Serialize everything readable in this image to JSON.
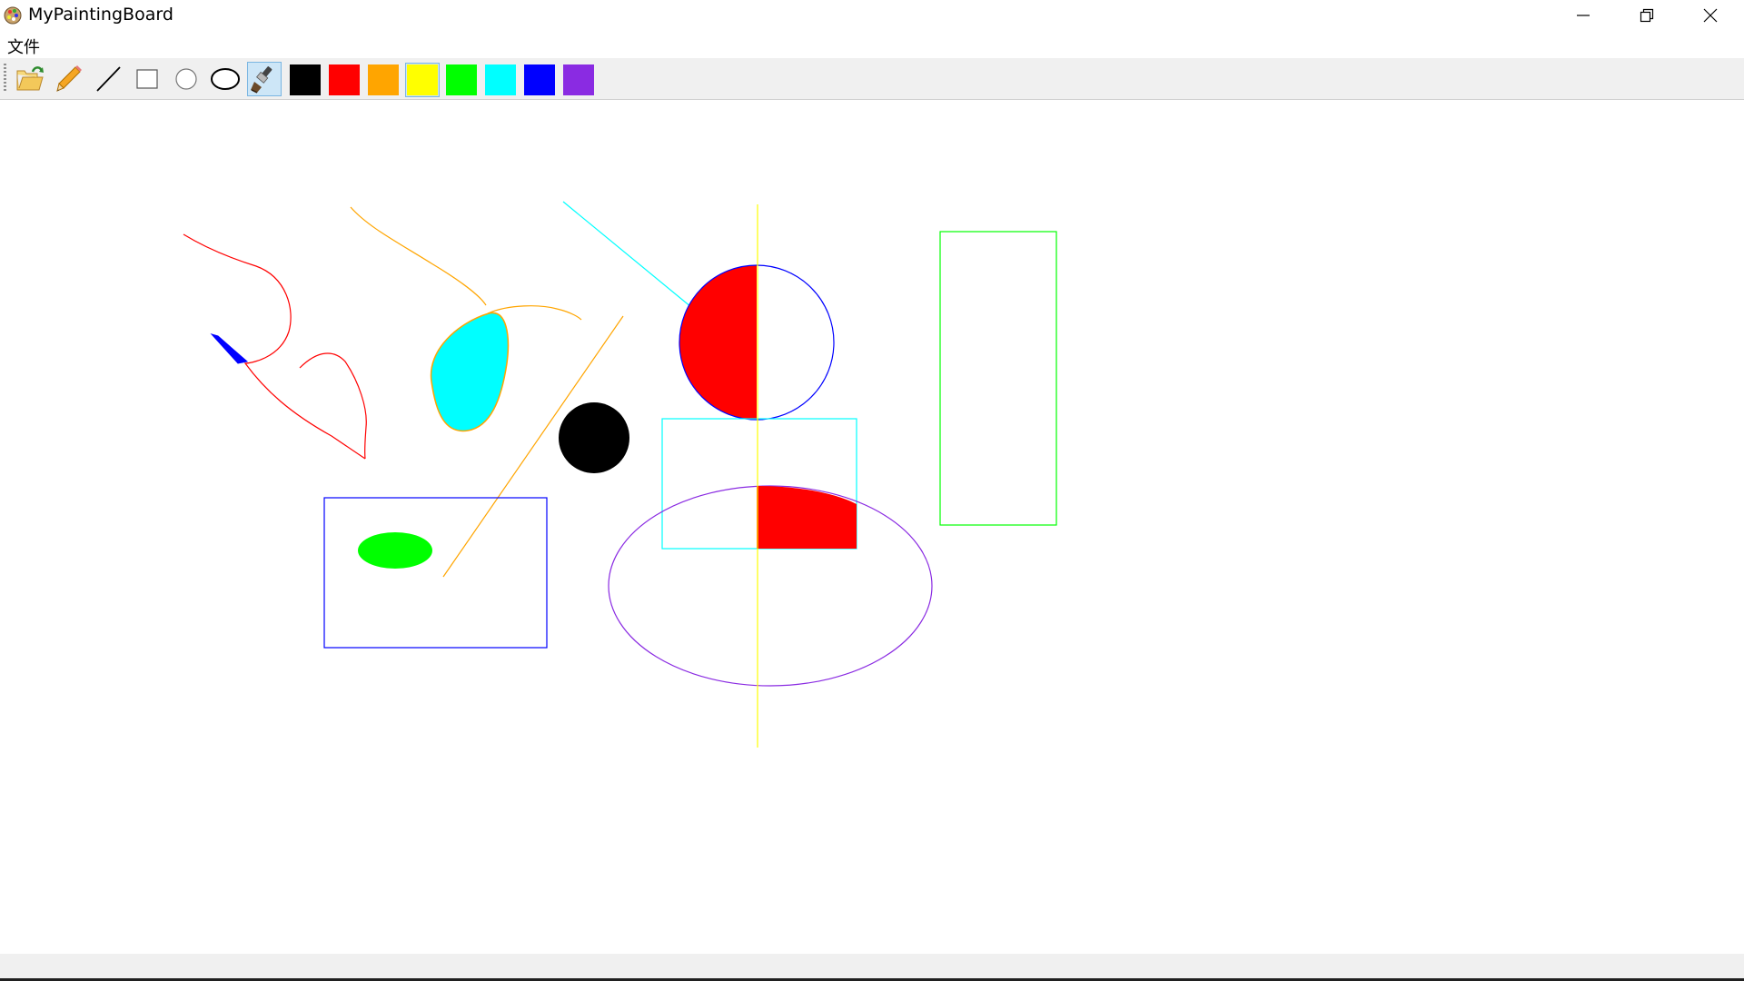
{
  "window": {
    "title": "MyPaintingBoard",
    "controls": [
      "minimize",
      "restore",
      "close"
    ]
  },
  "menu": {
    "items": [
      {
        "label": "文件"
      }
    ]
  },
  "toolbar": {
    "tools": [
      {
        "name": "open",
        "icon": "open-folder-icon"
      },
      {
        "name": "pencil",
        "icon": "pencil-icon"
      },
      {
        "name": "line",
        "icon": "line-icon"
      },
      {
        "name": "rectangle",
        "icon": "rectangle-icon"
      },
      {
        "name": "circle",
        "icon": "circle-icon"
      },
      {
        "name": "ellipse",
        "icon": "ellipse-icon"
      },
      {
        "name": "fill-brush",
        "icon": "paint-brush-icon",
        "selected": true
      }
    ],
    "colors": [
      {
        "name": "black",
        "hex": "#000000"
      },
      {
        "name": "red",
        "hex": "#ff0000"
      },
      {
        "name": "orange",
        "hex": "#ffa500"
      },
      {
        "name": "yellow",
        "hex": "#ffff00",
        "selected": true
      },
      {
        "name": "green",
        "hex": "#00ff00"
      },
      {
        "name": "cyan",
        "hex": "#00ffff"
      },
      {
        "name": "blue",
        "hex": "#0000ff"
      },
      {
        "name": "purple",
        "hex": "#8a2be2"
      }
    ]
  },
  "canvas": {
    "background": "#ffffff",
    "drawn_shapes": [
      {
        "type": "freehand",
        "color": "#ff0000"
      },
      {
        "type": "freehand",
        "color": "#ffa500"
      },
      {
        "type": "filled-blob",
        "color": "#00ffff"
      },
      {
        "type": "filled-stroke",
        "color": "#0000ff"
      },
      {
        "type": "line",
        "color": "#00ffff"
      },
      {
        "type": "line",
        "color": "#ffa500"
      },
      {
        "type": "line",
        "color": "#ffff00"
      },
      {
        "type": "filled-circle",
        "color": "#000000"
      },
      {
        "type": "circle",
        "color": "#0000ff",
        "fill": "#ff0000"
      },
      {
        "type": "rectangle",
        "color": "#0000ff"
      },
      {
        "type": "filled-ellipse",
        "color": "#00ff00"
      },
      {
        "type": "rectangle",
        "color": "#00ffff",
        "fill": "#ff0000"
      },
      {
        "type": "ellipse",
        "color": "#8a2be2"
      },
      {
        "type": "rectangle",
        "color": "#00ff00"
      }
    ]
  }
}
